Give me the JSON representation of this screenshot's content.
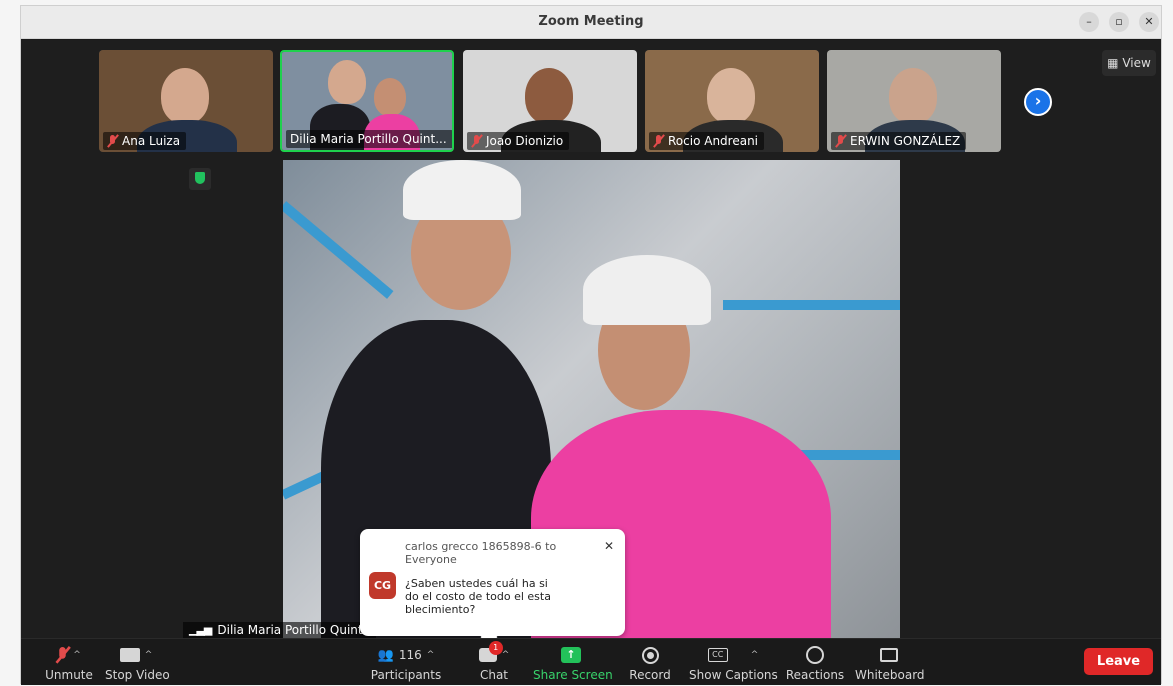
{
  "window": {
    "title": "Zoom Meeting"
  },
  "gallery": {
    "participants": [
      {
        "name": "Ana Luiza",
        "muted": true,
        "active": false,
        "bg": "#6b4f36"
      },
      {
        "name": "Dilia Maria Portillo Quint...",
        "muted": false,
        "active": true,
        "bg": "#7f8fa0"
      },
      {
        "name": "Joao Dionizio",
        "muted": true,
        "active": false,
        "bg": "#d7d7d7"
      },
      {
        "name": "Rocio Andreani",
        "muted": true,
        "active": false,
        "bg": "#8a6a4a"
      },
      {
        "name": "ERWIN GONZÁLEZ",
        "muted": true,
        "active": false,
        "bg": "#a8a8a4"
      }
    ],
    "view_label": "View"
  },
  "speaker": {
    "name": "Dilia Maria Portillo Quinte"
  },
  "chat_popup": {
    "from": "carlos grecco 1865898-6 to Everyone",
    "initials": "CG",
    "message": "¿Saben ustedes cuál ha si do el costo de todo el esta blecimiento?"
  },
  "toolbar": {
    "unmute": "Unmute",
    "stop_video": "Stop Video",
    "participants": "Participants",
    "participant_count": "116",
    "chat": "Chat",
    "chat_badge": "1",
    "share_screen": "Share Screen",
    "record": "Record",
    "show_captions": "Show Captions",
    "captions_icon": "CC",
    "reactions": "Reactions",
    "whiteboard": "Whiteboard",
    "leave": "Leave"
  },
  "colors": {
    "accent_green": "#1fd14d",
    "leave_red": "#e02828",
    "share_green": "#23c15a",
    "next_blue": "#1a73e8"
  }
}
